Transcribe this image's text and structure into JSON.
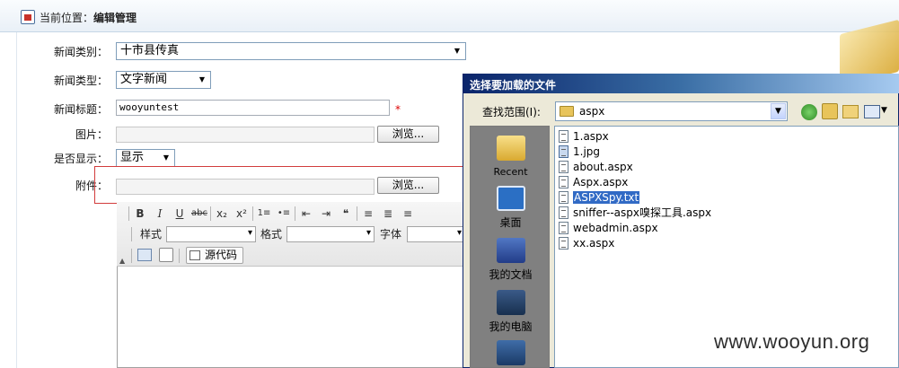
{
  "breadcrumb": {
    "prefix": "当前位置：",
    "current": "编辑管理"
  },
  "form": {
    "category_label": "新闻类别：",
    "category_value": "十市县传真",
    "type_label": "新闻类型：",
    "type_value": "文字新闻",
    "title_label": "新闻标题：",
    "title_value": "wooyuntest",
    "required_mark": "*",
    "image_label": "图片：",
    "browse_label": "浏览...",
    "display_label": "是否显示：",
    "display_value": "显示",
    "attachment_label": "附件：",
    "attachment_browse_label": "浏览..."
  },
  "editor": {
    "toolbar_buttons": [
      "B",
      "I",
      "U",
      "abc",
      "x₂",
      "x²",
      "1≡",
      "•≡",
      "⇤",
      "⇥",
      "❝",
      "≡",
      "≣",
      "≡"
    ],
    "style_label": "样式",
    "format_label": "格式",
    "font_label": "字体",
    "source_label": "源代码"
  },
  "dialog": {
    "title": "选择要加载的文件",
    "look_in_label": "查找范围(I):",
    "look_in_value": "aspx",
    "places": [
      {
        "label": "Recent",
        "icon": "recent-folder-icon"
      },
      {
        "label": "桌面",
        "icon": "desktop-icon"
      },
      {
        "label": "我的文档",
        "icon": "my-documents-icon"
      },
      {
        "label": "我的电脑",
        "icon": "my-computer-icon"
      },
      {
        "label": "",
        "icon": "network-places-icon"
      }
    ],
    "files": [
      {
        "name": "1.aspx",
        "type": "doc"
      },
      {
        "name": "1.jpg",
        "type": "jpg"
      },
      {
        "name": "about.aspx",
        "type": "doc"
      },
      {
        "name": "Aspx.aspx",
        "type": "doc"
      },
      {
        "name": "ASPXSpy.txt",
        "type": "doc",
        "selected": true
      },
      {
        "name": "sniffer--aspx嗅探工具.aspx",
        "type": "doc"
      },
      {
        "name": "webadmin.aspx",
        "type": "doc"
      },
      {
        "name": "xx.aspx",
        "type": "doc"
      }
    ]
  },
  "watermark": "www.wooyun.org",
  "colors": {
    "selection": "#316ac5",
    "title_bar": "#0a246a",
    "highlight_box": "#d23c3c"
  }
}
